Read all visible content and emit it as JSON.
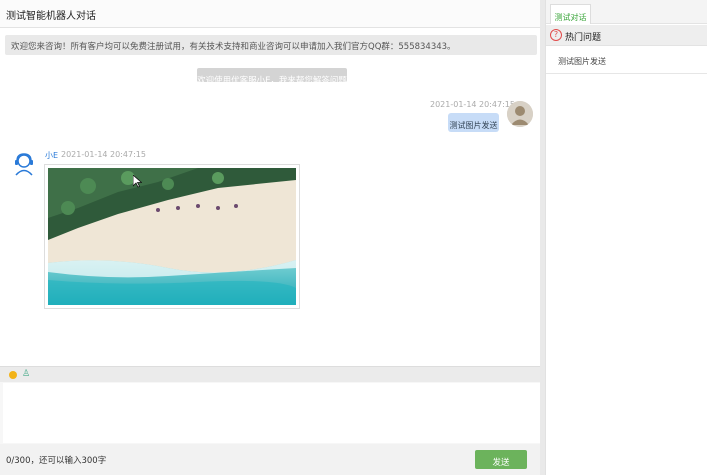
{
  "header": {
    "title": "测试智能机器人对话"
  },
  "chat": {
    "notice": "欢迎您来咨询！所有客户均可以免费注册试用，有关技术支持和商业咨询可以申请加入我们官方QQ群：555834343。",
    "system_message": "欢迎使用优客服小E，我来帮您解答问题",
    "user_message": {
      "timestamp": "2021-01-14 20:47:15",
      "text": "测试图片发送"
    },
    "bot_message": {
      "name": "小E",
      "timestamp": "2021-01-14 20:47:15"
    }
  },
  "composer": {
    "counter": "0/300，还可以输入300字",
    "send_label": "发送"
  },
  "sidebar": {
    "tab_label": "测试对话",
    "hot_title": "热门问题",
    "hot_items": [
      "测试图片发送"
    ]
  },
  "colors": {
    "send": "#6cb35c",
    "user_bubble": "#c7dcf7",
    "tab_text": "#3aa53a",
    "hot_icon": "#e14b4b"
  }
}
